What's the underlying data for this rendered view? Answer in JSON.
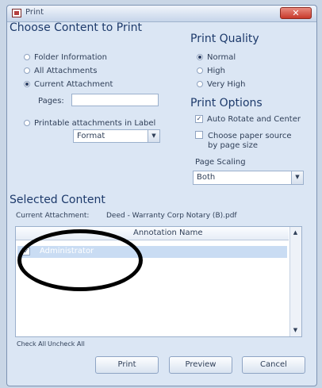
{
  "window": {
    "title": "Print",
    "close_glyph": "✕"
  },
  "content_section": {
    "title": "Choose Content to Print",
    "options": [
      "Folder Information",
      "All Attachments",
      "Current Attachment"
    ],
    "selected": "Current Attachment",
    "pages_label": "Pages:",
    "pages_value": "",
    "printable_label": "Printable attachments in Label",
    "printable_combo": "Format"
  },
  "quality_section": {
    "title": "Print Quality",
    "options": [
      "Normal",
      "High",
      "Very High"
    ],
    "selected": "Normal"
  },
  "print_options": {
    "title": "Print Options",
    "auto_rotate": "Auto Rotate and Center",
    "auto_rotate_checked": true,
    "choose_paper": "Choose paper source by page size",
    "choose_paper_checked": false,
    "page_scaling_label": "Page Scaling",
    "page_scaling_value": "Both"
  },
  "selected_content": {
    "title": "Selected Content",
    "current_label": "Current Attachment:",
    "current_value": "Deed - Warranty Corp Notary (B).pdf",
    "column_header": "Annotation Name",
    "rows": [
      {
        "label": "Administrator",
        "checked": true
      }
    ],
    "check_all": "Check All",
    "uncheck_all": "Uncheck All"
  },
  "buttons": {
    "print": "Print",
    "preview": "Preview",
    "cancel": "Cancel"
  },
  "icons": {
    "scroll_up": "▲",
    "scroll_down": "▼",
    "dropdown": "▼",
    "checkmark": "✓"
  }
}
